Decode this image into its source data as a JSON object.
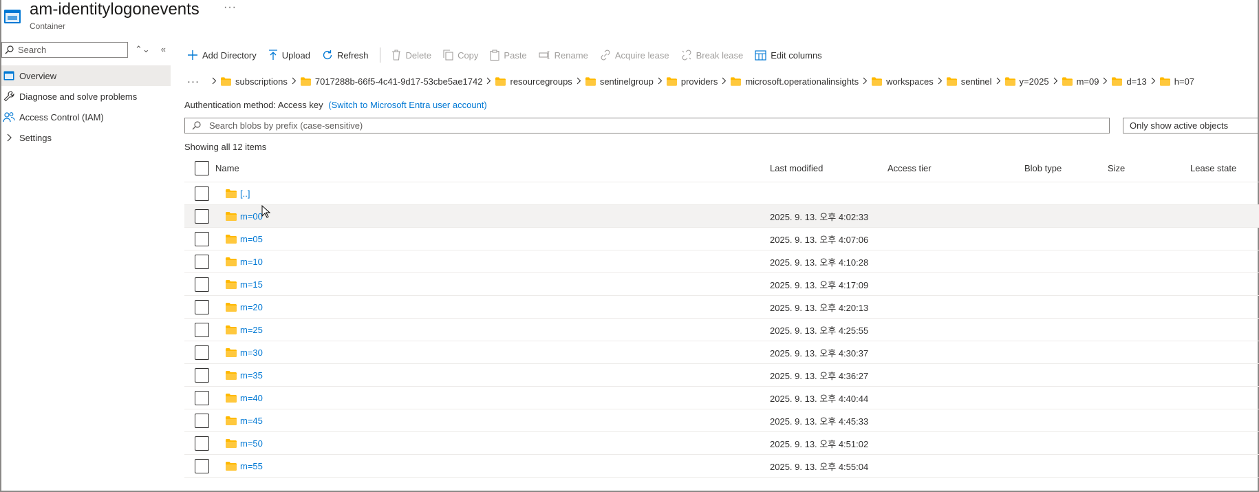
{
  "header": {
    "title": "am-identitylogonevents",
    "subtitle": "Container",
    "more": "···"
  },
  "sidebar": {
    "search_placeholder": "Search",
    "items": [
      {
        "label": "Overview",
        "icon": "container-icon",
        "active": true
      },
      {
        "label": "Diagnose and solve problems",
        "icon": "wrench-icon",
        "active": false
      },
      {
        "label": "Access Control (IAM)",
        "icon": "people-icon",
        "active": false
      },
      {
        "label": "Settings",
        "icon": "chevron-right-icon",
        "active": false
      }
    ]
  },
  "toolbar": {
    "add_directory": "Add Directory",
    "upload": "Upload",
    "refresh": "Refresh",
    "delete": "Delete",
    "copy": "Copy",
    "paste": "Paste",
    "rename": "Rename",
    "acquire_lease": "Acquire lease",
    "break_lease": "Break lease",
    "edit_columns": "Edit columns"
  },
  "breadcrumb": {
    "more": "···",
    "items": [
      "subscriptions",
      "7017288b-66f5-4c41-9d17-53cbe5ae1742",
      "resourcegroups",
      "sentinelgroup",
      "providers",
      "microsoft.operationalinsights",
      "workspaces",
      "sentinel",
      "y=2025",
      "m=09",
      "d=13",
      "h=07"
    ]
  },
  "auth": {
    "label": "Authentication method:",
    "value": "Access key",
    "link": "(Switch to Microsoft Entra user account)"
  },
  "blob_search": {
    "placeholder": "Search blobs by prefix (case-sensitive)"
  },
  "filter": {
    "selected": "Only show active objects"
  },
  "count_text": "Showing all 12 items",
  "table": {
    "columns": {
      "name": "Name",
      "last_modified": "Last modified",
      "access_tier": "Access tier",
      "blob_type": "Blob type",
      "size": "Size",
      "lease_state": "Lease state"
    },
    "rows": [
      {
        "name": "[..]",
        "modified": ""
      },
      {
        "name": "m=00",
        "modified": "2025. 9. 13. 오후 4:02:33"
      },
      {
        "name": "m=05",
        "modified": "2025. 9. 13. 오후 4:07:06"
      },
      {
        "name": "m=10",
        "modified": "2025. 9. 13. 오후 4:10:28"
      },
      {
        "name": "m=15",
        "modified": "2025. 9. 13. 오후 4:17:09"
      },
      {
        "name": "m=20",
        "modified": "2025. 9. 13. 오후 4:20:13"
      },
      {
        "name": "m=25",
        "modified": "2025. 9. 13. 오후 4:25:55"
      },
      {
        "name": "m=30",
        "modified": "2025. 9. 13. 오후 4:30:37"
      },
      {
        "name": "m=35",
        "modified": "2025. 9. 13. 오후 4:36:27"
      },
      {
        "name": "m=40",
        "modified": "2025. 9. 13. 오후 4:40:44"
      },
      {
        "name": "m=45",
        "modified": "2025. 9. 13. 오후 4:45:33"
      },
      {
        "name": "m=50",
        "modified": "2025. 9. 13. 오후 4:51:02"
      },
      {
        "name": "m=55",
        "modified": "2025. 9. 13. 오후 4:55:04"
      }
    ]
  },
  "colors": {
    "accent": "#0078d4",
    "folder": "#ffb900",
    "active_nav": "#edebe9",
    "hover_row": "#f3f2f1"
  }
}
